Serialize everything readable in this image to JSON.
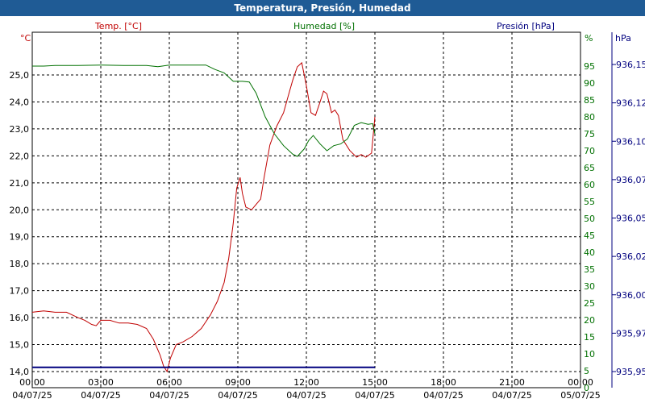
{
  "window": {
    "title": "Temperatura, Presión, Humedad"
  },
  "colors": {
    "temp": "#c00000",
    "humidity": "#007000",
    "pressure": "#00007f",
    "title_bg": "#1f5b95",
    "grid": "#000000"
  },
  "chart_data": {
    "type": "line",
    "title": "Temperatura, Presión, Humedad",
    "grid": true,
    "x_ticks": [
      {
        "time": "00:00",
        "date": "04/07/25"
      },
      {
        "time": "03:00",
        "date": "04/07/25"
      },
      {
        "time": "06:00",
        "date": "04/07/25"
      },
      {
        "time": "09:00",
        "date": "04/07/25"
      },
      {
        "time": "12:00",
        "date": "04/07/25"
      },
      {
        "time": "15:00",
        "date": "04/07/25"
      },
      {
        "time": "18:00",
        "date": "04/07/25"
      },
      {
        "time": "21:00",
        "date": "04/07/25"
      },
      {
        "time": "00:00",
        "date": "05/07/25"
      }
    ],
    "x_range_hours": [
      0,
      24
    ],
    "axes": {
      "temp": {
        "unit_label": "°C",
        "series_label": "Temp. [°C]",
        "range": [
          13.6,
          26.0
        ],
        "ticks": [
          "14,0",
          "15,0",
          "16,0",
          "17,0",
          "18,0",
          "19,0",
          "20,0",
          "21,0",
          "22,0",
          "23,0",
          "24,0",
          "25,0"
        ]
      },
      "humidity": {
        "unit_label": "%",
        "series_label": "Humedad [%]",
        "range": [
          0,
          100
        ],
        "ticks": [
          "0",
          "5",
          "10",
          "15",
          "20",
          "25",
          "30",
          "35",
          "40",
          "45",
          "50",
          "55",
          "60",
          "65",
          "70",
          "75",
          "80",
          "85",
          "90",
          "95"
        ]
      },
      "pressure": {
        "unit_label": "hPa",
        "series_label": "Presión [hPa]",
        "ticks": [
          "935,95",
          "935,97",
          "936,00",
          "936,02",
          "936,05",
          "936,07",
          "936,10",
          "936,12",
          "936,15"
        ]
      }
    },
    "series": [
      {
        "name": "Temp. [°C]",
        "axis": "temp",
        "points": [
          [
            0.0,
            16.2
          ],
          [
            0.5,
            16.25
          ],
          [
            1.0,
            16.2
          ],
          [
            1.5,
            16.2
          ],
          [
            2.0,
            16.0
          ],
          [
            2.3,
            15.9
          ],
          [
            2.6,
            15.75
          ],
          [
            2.8,
            15.7
          ],
          [
            3.0,
            15.9
          ],
          [
            3.4,
            15.9
          ],
          [
            3.8,
            15.8
          ],
          [
            4.2,
            15.8
          ],
          [
            4.6,
            15.75
          ],
          [
            5.0,
            15.6
          ],
          [
            5.3,
            15.2
          ],
          [
            5.6,
            14.6
          ],
          [
            5.75,
            14.2
          ],
          [
            5.9,
            14.0
          ],
          [
            6.05,
            14.5
          ],
          [
            6.3,
            15.0
          ],
          [
            6.6,
            15.1
          ],
          [
            7.0,
            15.3
          ],
          [
            7.4,
            15.6
          ],
          [
            7.8,
            16.1
          ],
          [
            8.1,
            16.6
          ],
          [
            8.4,
            17.3
          ],
          [
            8.6,
            18.2
          ],
          [
            8.8,
            19.5
          ],
          [
            8.95,
            20.8
          ],
          [
            9.1,
            21.2
          ],
          [
            9.2,
            20.6
          ],
          [
            9.35,
            20.1
          ],
          [
            9.6,
            20.0
          ],
          [
            9.8,
            20.2
          ],
          [
            10.0,
            20.4
          ],
          [
            10.15,
            21.2
          ],
          [
            10.4,
            22.4
          ],
          [
            10.7,
            23.1
          ],
          [
            11.0,
            23.6
          ],
          [
            11.2,
            24.2
          ],
          [
            11.4,
            24.8
          ],
          [
            11.6,
            25.3
          ],
          [
            11.8,
            25.45
          ],
          [
            12.0,
            24.6
          ],
          [
            12.2,
            23.6
          ],
          [
            12.4,
            23.5
          ],
          [
            12.6,
            24.0
          ],
          [
            12.75,
            24.4
          ],
          [
            12.9,
            24.3
          ],
          [
            13.1,
            23.6
          ],
          [
            13.25,
            23.7
          ],
          [
            13.4,
            23.5
          ],
          [
            13.6,
            22.6
          ],
          [
            13.9,
            22.2
          ],
          [
            14.2,
            21.95
          ],
          [
            14.4,
            22.05
          ],
          [
            14.6,
            21.95
          ],
          [
            14.85,
            22.1
          ],
          [
            15.0,
            23.45
          ]
        ]
      },
      {
        "name": "Humedad [%]",
        "axis": "humidity",
        "points": [
          [
            0.0,
            95.0
          ],
          [
            0.5,
            95.0
          ],
          [
            1.0,
            95.2
          ],
          [
            2.0,
            95.2
          ],
          [
            3.0,
            95.3
          ],
          [
            4.0,
            95.2
          ],
          [
            5.0,
            95.2
          ],
          [
            5.5,
            94.8
          ],
          [
            6.0,
            95.3
          ],
          [
            7.0,
            95.3
          ],
          [
            7.6,
            95.3
          ],
          [
            8.0,
            94.0
          ],
          [
            8.4,
            93.0
          ],
          [
            8.8,
            90.5
          ],
          [
            9.2,
            90.5
          ],
          [
            9.5,
            90.3
          ],
          [
            9.8,
            87.0
          ],
          [
            10.2,
            80.0
          ],
          [
            10.6,
            75.0
          ],
          [
            11.0,
            71.5
          ],
          [
            11.4,
            69.0
          ],
          [
            11.6,
            68.3
          ],
          [
            11.9,
            70.5
          ],
          [
            12.1,
            73.0
          ],
          [
            12.3,
            74.5
          ],
          [
            12.6,
            72.0
          ],
          [
            12.9,
            70.0
          ],
          [
            13.2,
            71.5
          ],
          [
            13.5,
            72.0
          ],
          [
            13.8,
            73.5
          ],
          [
            14.1,
            77.5
          ],
          [
            14.4,
            78.3
          ],
          [
            14.7,
            77.8
          ],
          [
            14.9,
            78.0
          ],
          [
            15.0,
            75.0
          ]
        ]
      },
      {
        "name": "Presión [hPa]",
        "axis": "pressure",
        "constant_at_hum": 6.0,
        "points_hours": [
          0,
          15
        ]
      }
    ]
  }
}
